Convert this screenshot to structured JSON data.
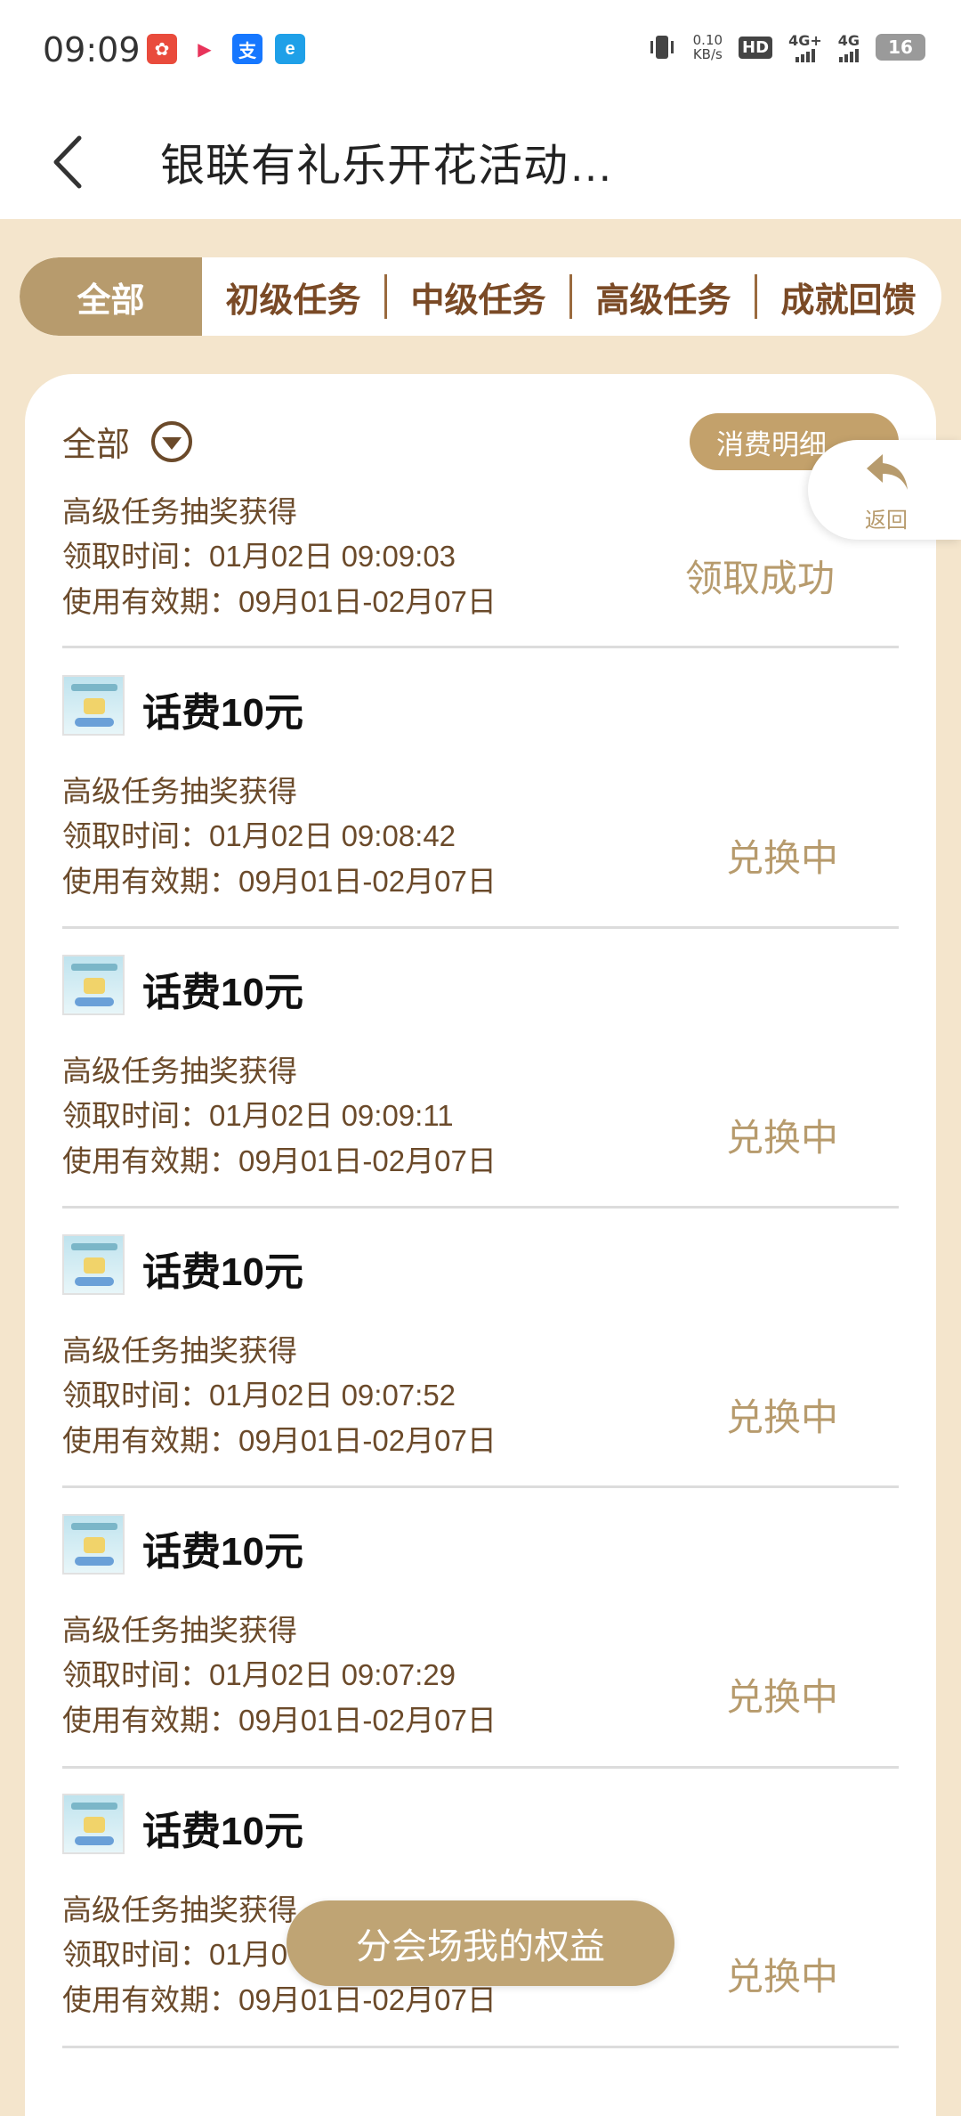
{
  "status_bar": {
    "time": "09:09",
    "net_speed_value": "0.10",
    "net_speed_unit": "KB/s",
    "hd": "HD",
    "net1": "4G+",
    "net2": "4G",
    "battery": "16"
  },
  "header": {
    "title": "银联有礼乐开花活动…"
  },
  "tabs": [
    {
      "label": "全部",
      "active": true
    },
    {
      "label": "初级任务",
      "active": false
    },
    {
      "label": "中级任务",
      "active": false
    },
    {
      "label": "高级任务",
      "active": false
    },
    {
      "label": "成就回馈",
      "active": false
    }
  ],
  "filter": {
    "label": "全部"
  },
  "detail_button": "消费明细",
  "float_back_label": "返回",
  "items": [
    {
      "name": "",
      "source": "高级任务抽奖获得",
      "claim_time": "领取时间：01月02日 09:09:03",
      "validity": "使用有效期：09月01日-02月07日",
      "status": "领取成功"
    },
    {
      "name": "话费10元",
      "source": "高级任务抽奖获得",
      "claim_time": "领取时间：01月02日 09:08:42",
      "validity": "使用有效期：09月01日-02月07日",
      "status": "兑换中"
    },
    {
      "name": "话费10元",
      "source": "高级任务抽奖获得",
      "claim_time": "领取时间：01月02日 09:09:11",
      "validity": "使用有效期：09月01日-02月07日",
      "status": "兑换中"
    },
    {
      "name": "话费10元",
      "source": "高级任务抽奖获得",
      "claim_time": "领取时间：01月02日 09:07:52",
      "validity": "使用有效期：09月01日-02月07日",
      "status": "兑换中"
    },
    {
      "name": "话费10元",
      "source": "高级任务抽奖获得",
      "claim_time": "领取时间：01月02日 09:07:29",
      "validity": "使用有效期：09月01日-02月07日",
      "status": "兑换中"
    },
    {
      "name": "话费10元",
      "source": "高级任务抽奖获得",
      "claim_time": "领取时间：01月0",
      "validity": "使用有效期：09月01日-02月07日",
      "status": "兑换中"
    }
  ],
  "bottom_button": "分会场我的权益"
}
